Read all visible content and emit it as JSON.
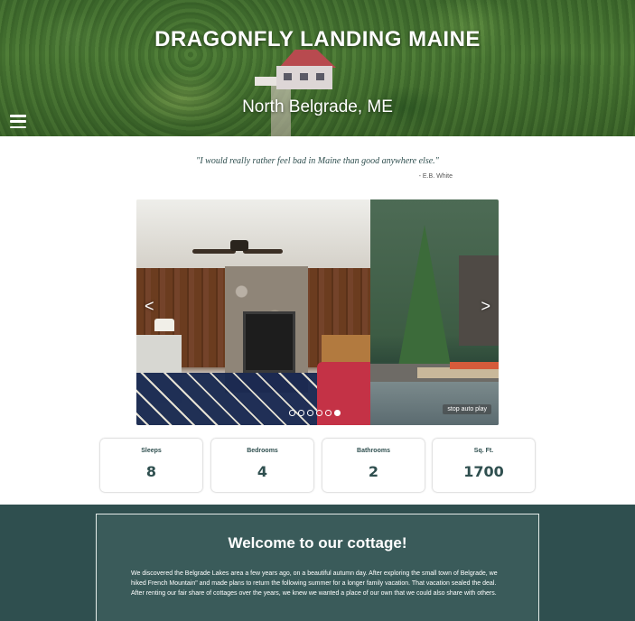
{
  "hero": {
    "title": "DRAGONFLY LANDING MAINE",
    "subtitle": "North Belgrade, ME",
    "menu_icon": "hamburger-menu-icon"
  },
  "quote": {
    "text": "\"I would really rather feel bad in Maine than good anywhere else.\"",
    "author": "- E.B. White"
  },
  "carousel": {
    "prev_label": "<",
    "next_label": ">",
    "slide_count": 6,
    "active_index": 5,
    "stop_label": "stop auto play"
  },
  "stats": [
    {
      "label": "Sleeps",
      "value": "8"
    },
    {
      "label": "Bedrooms",
      "value": "4"
    },
    {
      "label": "Bathrooms",
      "value": "2"
    },
    {
      "label": "Sq. Ft.",
      "value": "1700"
    }
  ],
  "welcome": {
    "title": "Welcome to our cottage!",
    "text": "We discovered the Belgrade Lakes area a few years ago, on a beautiful autumn day. After exploring the small town of Belgrade, we hiked French Mountain\" and made plans to return the following summer for a longer family vacation. That vacation sealed the deal. After renting our fair share of cottages over the years, we knew we wanted a place of our own that we could also share with others."
  },
  "colors": {
    "brand_dark": "#2f4f4f",
    "welcome_box": "#3a5b5a",
    "white": "#ffffff"
  }
}
